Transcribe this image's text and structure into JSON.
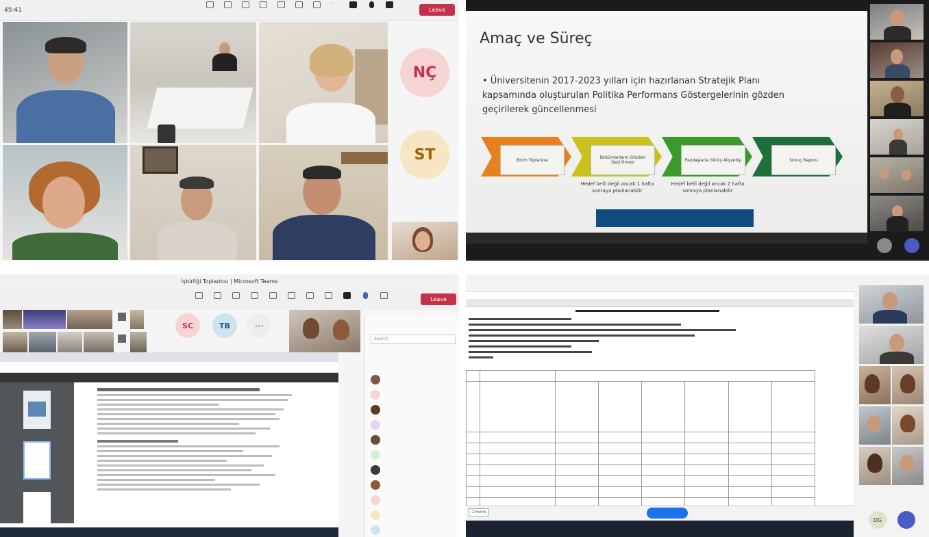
{
  "q1": {
    "timer": "45:41",
    "toolbar": {
      "leave_label": "Leave"
    },
    "avatars": [
      {
        "initials": "NÇ",
        "color": "#f7d4d4",
        "text_color": "#c4314b"
      },
      {
        "initials": "ST",
        "color": "#f7e6c4",
        "text_color": "#a0630a"
      }
    ]
  },
  "q2": {
    "slide": {
      "title": "Amaç ve Süreç",
      "bullet": "• Üniversitenin 2017-2023 yılları için hazırlanan Stratejik Planı kapsamında oluşturulan Politika Performans Göstergelerinin gözden geçirilerek güncellenmesi",
      "steps": [
        {
          "label": "Birim Toplantısı",
          "color": "#e8801e"
        },
        {
          "label": "Dokümanların Gözden Geçirilmesi",
          "color": "#c9c21a"
        },
        {
          "label": "Paydaşlarla Görüş Alışverişi",
          "color": "#3a9b2c"
        },
        {
          "label": "Sonuç Raporu",
          "color": "#1f6f3a"
        }
      ],
      "notes": [
        "Hedef belli değil ancak 1 hafta sonraya planlanabilir",
        "Hedef belli değil ancak 2 hafta sonraya planlanabilir"
      ]
    }
  },
  "q3": {
    "window_title": "İşbirliği Toplantısı | Microsoft Teams",
    "toolbar": {
      "leave_label": "Leave"
    },
    "mini_avatars": [
      {
        "initials": "SC",
        "color": "#f7d4d4",
        "text_color": "#c4314b"
      },
      {
        "initials": "TB",
        "color": "#cfe3ef",
        "text_color": "#1d5f8a"
      },
      {
        "initials": "···",
        "color": "#eeeeee",
        "text_color": "#888888"
      }
    ],
    "panel": {
      "search_placeholder": "Search"
    }
  },
  "q4": {
    "sheet_tab": "2 Metrik",
    "colors": {
      "excel_green": "#1e6b31",
      "pill_blue": "#1a73e8"
    },
    "user_initials": "DG"
  }
}
